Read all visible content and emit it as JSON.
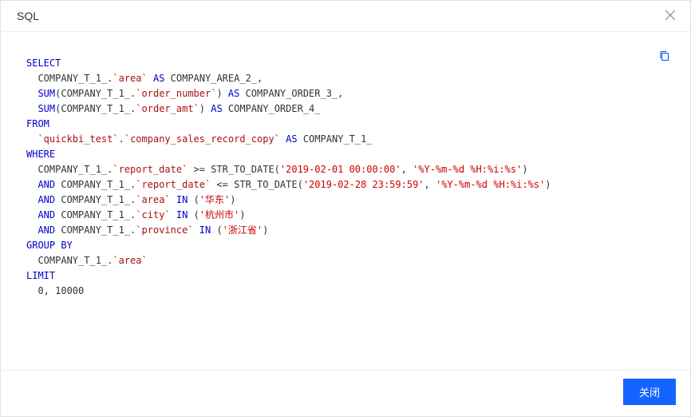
{
  "header": {
    "title": "SQL"
  },
  "footer": {
    "close_label": "关闭"
  },
  "icons": {
    "close": "close-icon",
    "copy": "copy-icon"
  },
  "sql": {
    "l01_kw": "SELECT",
    "l02_a": "  COMPANY_T_1_.",
    "l02_id": "`area`",
    "l02_b": " ",
    "l02_kw": "AS",
    "l02_c": " COMPANY_AREA_2_,",
    "l03_a": "  ",
    "l03_kw1": "SUM",
    "l03_b": "(COMPANY_T_1_.",
    "l03_id": "`order_number`",
    "l03_c": ") ",
    "l03_kw2": "AS",
    "l03_d": " COMPANY_ORDER_3_,",
    "l04_a": "  ",
    "l04_kw1": "SUM",
    "l04_b": "(COMPANY_T_1_.",
    "l04_id": "`order_amt`",
    "l04_c": ") ",
    "l04_kw2": "AS",
    "l04_d": " COMPANY_ORDER_4_",
    "l05_kw": "FROM",
    "l06_a": "  ",
    "l06_id1": "`quickbi_test`",
    "l06_b": ".",
    "l06_id2": "`company_sales_record_copy`",
    "l06_c": " ",
    "l06_kw": "AS",
    "l06_d": " COMPANY_T_1_",
    "l07_kw": "WHERE",
    "l08_a": "  COMPANY_T_1_.",
    "l08_id": "`report_date`",
    "l08_b": " >= STR_TO_DATE(",
    "l08_s1": "'2019-02-01 00:00:00'",
    "l08_c": ", ",
    "l08_s2": "'%Y-%m-%d %H:%i:%s'",
    "l08_d": ")",
    "l09_a": "  ",
    "l09_kw": "AND",
    "l09_b": " COMPANY_T_1_.",
    "l09_id": "`report_date`",
    "l09_c": " <= STR_TO_DATE(",
    "l09_s1": "'2019-02-28 23:59:59'",
    "l09_d": ", ",
    "l09_s2": "'%Y-%m-%d %H:%i:%s'",
    "l09_e": ")",
    "l10_a": "  ",
    "l10_kw1": "AND",
    "l10_b": " COMPANY_T_1_.",
    "l10_id": "`area`",
    "l10_c": " ",
    "l10_kw2": "IN",
    "l10_d": " (",
    "l10_s": "'华东'",
    "l10_e": ")",
    "l11_a": "  ",
    "l11_kw1": "AND",
    "l11_b": " COMPANY_T_1_.",
    "l11_id": "`city`",
    "l11_c": " ",
    "l11_kw2": "IN",
    "l11_d": " (",
    "l11_s": "'杭州市'",
    "l11_e": ")",
    "l12_a": "  ",
    "l12_kw1": "AND",
    "l12_b": " COMPANY_T_1_.",
    "l12_id": "`province`",
    "l12_c": " ",
    "l12_kw2": "IN",
    "l12_d": " (",
    "l12_s": "'浙江省'",
    "l12_e": ")",
    "l13_kw": "GROUP BY",
    "l14_a": "  COMPANY_T_1_.",
    "l14_id": "`area`",
    "l15_kw": "LIMIT",
    "l16": "  0, 10000"
  }
}
